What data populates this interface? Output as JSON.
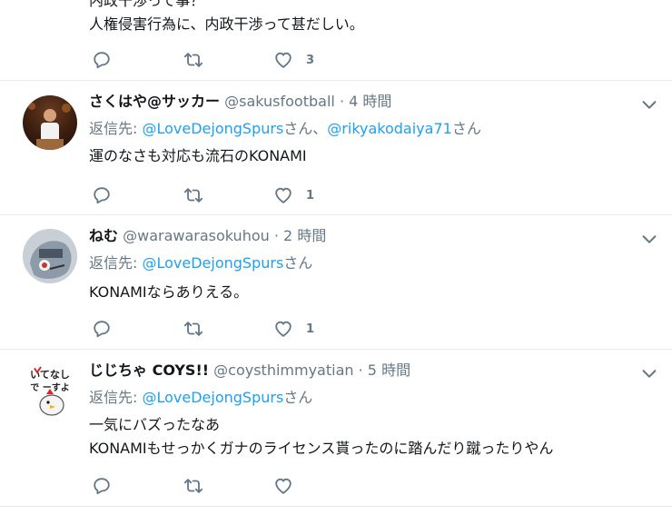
{
  "tweets": [
    {
      "text_lines": [
        "内政干渉って事？",
        "人権侵害行為に、内政干渉って甚だしい。"
      ],
      "like_count": "3"
    },
    {
      "name": "さくはや@サッカー",
      "handle": "@sakusfootball",
      "time": "4 時間",
      "reply_prefix": "返信先: ",
      "mentions": [
        "@LoveDejongSpurs",
        "@rikyakodaiya71"
      ],
      "mention_suffix": "さん",
      "mention_separator": "さん、",
      "text_lines": [
        "運のなさも対応も流石のKONAMI"
      ],
      "like_count": "1"
    },
    {
      "name": "ねむ",
      "handle": "@warawarasokuhou",
      "time": "2 時間",
      "reply_prefix": "返信先: ",
      "mentions": [
        "@LoveDejongSpurs"
      ],
      "mention_suffix": "さん",
      "text_lines": [
        "KONAMIならありえる。"
      ],
      "like_count": "1"
    },
    {
      "name": "じじちゃ COYS!!",
      "handle": "@coysthimmyatian",
      "time": "5 時間",
      "reply_prefix": "返信先: ",
      "mentions": [
        "@LoveDejongSpurs"
      ],
      "mention_suffix": "さん",
      "text_lines": [
        "一気にバズったなあ",
        "KONAMIもせっかくガナのライセンス貰ったのに踏んだり蹴ったりやん"
      ],
      "like_count": "",
      "avatar_text": [
        "いてなし",
        "で ーすよ"
      ]
    }
  ],
  "separator": "·",
  "colors": {
    "link": "#1da1f2",
    "secondary": "#657786",
    "divider": "#e6ecf0",
    "primary_text": "#14171a"
  },
  "icons": {
    "reply": "reply-icon",
    "retweet": "retweet-icon",
    "like": "heart-icon",
    "more": "chevron-down-icon"
  }
}
